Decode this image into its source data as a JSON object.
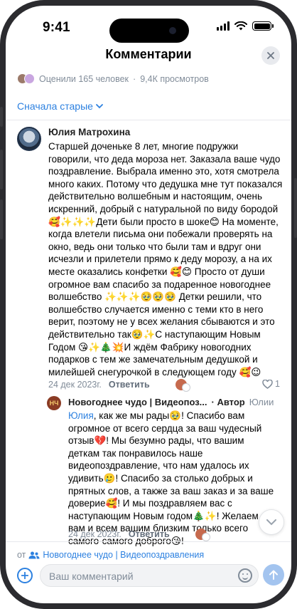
{
  "status_bar": {
    "time": "9:41"
  },
  "header": {
    "title": "Комментарии"
  },
  "meta": {
    "likes": "Оценили 165 человек",
    "views": "9,4К просмотров"
  },
  "sort": {
    "label": "Сначала старые"
  },
  "comment": {
    "author": "Юлия Матрохина",
    "text": "Старшей доченьке 8 лет, многие подружки говорили, что деда мороза нет. Заказала ваше чудо поздравление. Выбрала именно это, хотя смотрела много каких. Потому что дедушка мне тут показался действительно волшебным и настоящим, очень искренний, добрый с натуральной по виду бородой🥰✨✨✨Дети были просто в шоке😊 На моменте, когда влетели письма они побежали проверять на окно, ведь они только что были там и вдруг они исчезли и прилетели прямо к деду морозу, а на их месте оказались конфетки 🥰😊 Просто от души огромное вам спасибо за подаренное новогоднее волшебство ✨✨✨🥹🥹🥹 Детки решили, что волшебство случается именно с теми кто в него верит, поэтому не у всех желания сбываются и это действительно так🥹✨С наступающим Новым Годом 😘✨🎄💥И ждём Фабрику новогодних подарков с тем же замечательным дедушкой и милейшей снегурочкой в следующем году 🥰😉",
    "date": "24 дек 2023г.",
    "reply_label": "Ответить",
    "likes_count": "1"
  },
  "reply": {
    "avatar_text": "НЧ",
    "author": "Новогоднее чудо | Видеопоз...",
    "role": "· Автор",
    "to": "Юлии",
    "mention": "Юлия",
    "text": ", как же мы рады🥹! Спасибо вам огромное от всего сердца за ваш чудесный отзыв💔! Мы безумно рады, что вашим деткам так понравилось наше видеопоздравление, что нам удалось их удивить🥲! Спасибо за столько добрых и прятных слов, а также за ваш заказ и за ваше доверие🥰! И мы поздравляем вас с наступающим Новым годом🎄✨! Желаем вам и всем вашим близким только всего самого-самого доброго😘!",
    "date": "24 дек 2023г.",
    "reply_label": "Ответить"
  },
  "footer": {
    "from_prefix": "от",
    "community": "Новогоднее чудо | Видеопоздравления",
    "input_placeholder": "Ваш комментарий"
  },
  "colors": {
    "accent": "#2d81e0",
    "secondary_text": "#818c99"
  },
  "icons": [
    "close-icon",
    "chevron-down-icon",
    "heart-icon",
    "community-icon",
    "add-icon",
    "emoji-icon",
    "send-icon",
    "scroll-down-icon"
  ]
}
